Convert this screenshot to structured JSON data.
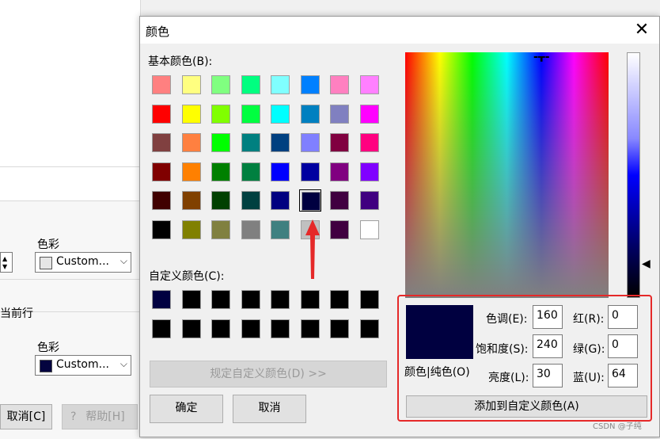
{
  "background_app": {
    "color_label_1": "色彩",
    "combo_1": "Custom...",
    "combo_1_swatch": "#e6e6e6",
    "current_row_label": "当前行",
    "color_label_2": "色彩",
    "combo_2": "Custom...",
    "combo_2_swatch": "#04043f",
    "cancel_button": "取消[C]",
    "help_button": "帮助[H]"
  },
  "dialog": {
    "title": "颜色",
    "close": "✕",
    "basic_colors_label": "基本颜色(B):",
    "basic_colors": [
      [
        "#ff8080",
        "#ffff80",
        "#80ff80",
        "#00ff80",
        "#80ffff",
        "#0080ff",
        "#ff80c0",
        "#ff80ff"
      ],
      [
        "#ff0000",
        "#ffff00",
        "#80ff00",
        "#00ff40",
        "#00ffff",
        "#0080c0",
        "#8080c0",
        "#ff00ff"
      ],
      [
        "#804040",
        "#ff8040",
        "#00ff00",
        "#008080",
        "#004080",
        "#8080ff",
        "#800040",
        "#ff0080"
      ],
      [
        "#800000",
        "#ff8000",
        "#008000",
        "#008040",
        "#0000ff",
        "#0000a0",
        "#800080",
        "#8000ff"
      ],
      [
        "#400000",
        "#804000",
        "#004000",
        "#004040",
        "#000080",
        "#000040",
        "#400040",
        "#400080"
      ],
      [
        "#000000",
        "#808000",
        "#808040",
        "#808080",
        "#408080",
        "#c0c0c0",
        "#400040",
        "#ffffff"
      ]
    ],
    "custom_colors_label": "自定义颜色(C):",
    "custom_colors": [
      [
        "#000040",
        "#000000",
        "#000000",
        "#000000",
        "#000000",
        "#000000",
        "#000000",
        "#000000"
      ],
      [
        "#000000",
        "#000000",
        "#000000",
        "#000000",
        "#000000",
        "#000000",
        "#000000",
        "#000000"
      ]
    ],
    "define_custom_button": "规定自定义颜色(D) >>",
    "ok_button": "确定",
    "cancel_button": "取消",
    "preview_color": "#000040",
    "preview_label": "颜色|纯色(O)",
    "hue_label": "色调(E):",
    "hue_value": "160",
    "sat_label": "饱和度(S):",
    "sat_value": "240",
    "lum_label": "亮度(L):",
    "lum_value": "30",
    "red_label": "红(R):",
    "red_value": "0",
    "green_label": "绿(G):",
    "green_value": "0",
    "blue_label": "蓝(U):",
    "blue_value": "64",
    "add_custom_button": "添加到自定义颜色(A)"
  },
  "annotation": {
    "highlight_color": "#e52929",
    "watermark": "CSDN @子纯"
  }
}
